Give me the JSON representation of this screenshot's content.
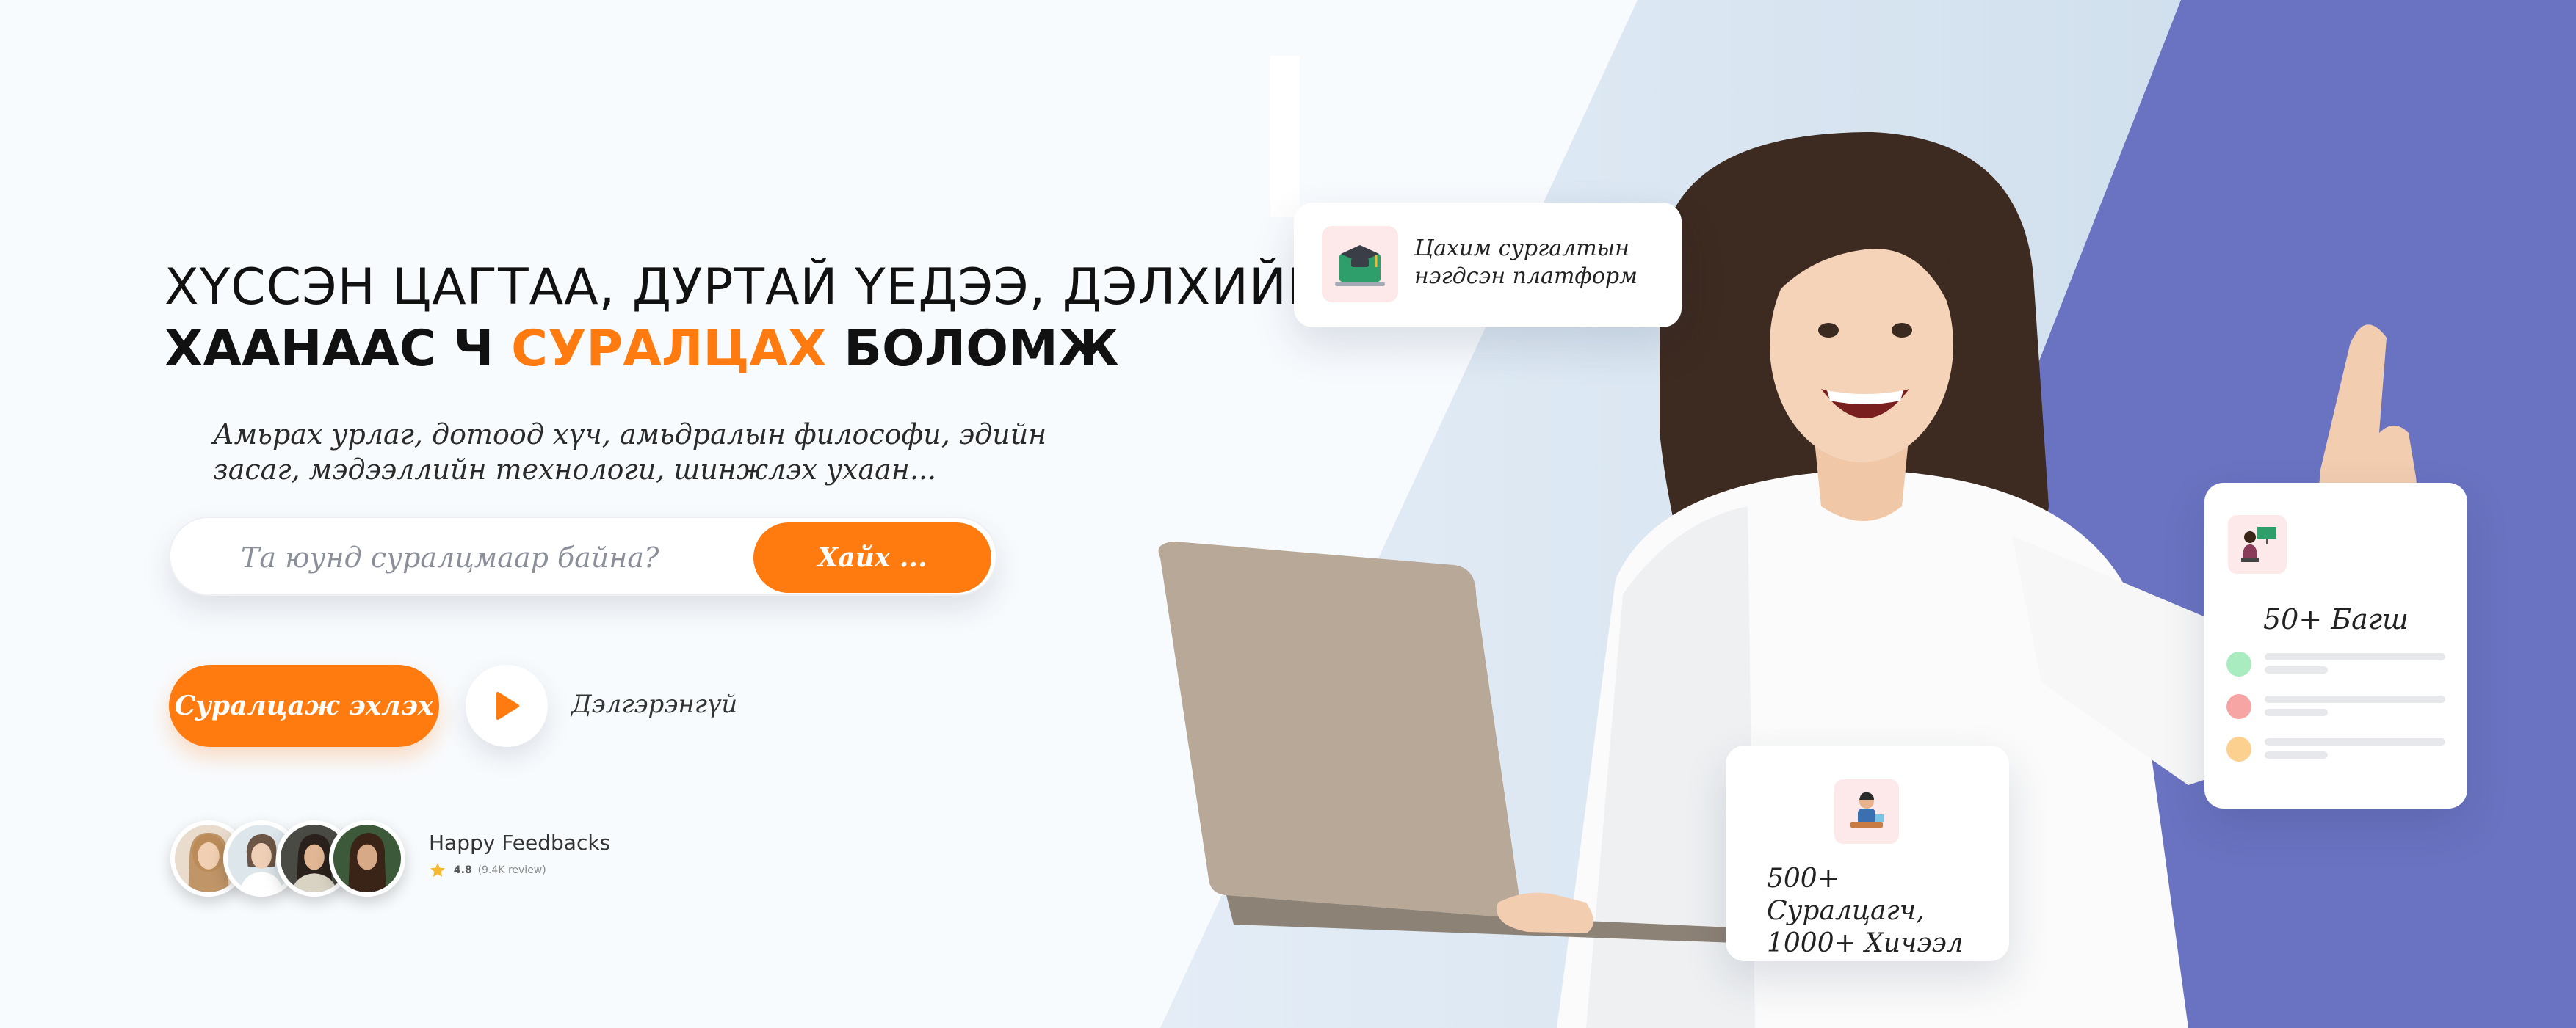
{
  "colors": {
    "accent": "#ff7a0f",
    "background": "#f8fbfe",
    "panel_light": "#d3e2f0",
    "panel_purple": "#6a73c1"
  },
  "hero": {
    "headline_line1": "ХҮССЭН ЦАГТАА, ДУРТАЙ ҮЕДЭЭ, ДЭЛХИЙН",
    "headline_line2_pre": "ХААНААС Ч ",
    "headline_line2_accent": "СУРАЛЦАХ",
    "headline_line2_post": " БОЛОМЖ",
    "subtitle": "Амьрах урлаг, дотоод хүч, амьдралын философи, эдийн засаг, мэдээллийн технологи, шинжлэх ухаан..."
  },
  "search": {
    "placeholder": "Та юунд суралцмаар байна?",
    "button_label": "Хайх ..."
  },
  "cta": {
    "start_label": "Суралцаж эхлэх",
    "play_icon": "play-icon",
    "more_label": "Дэлгэрэнгүй"
  },
  "feedback": {
    "title": "Happy Feedbacks",
    "rating": "4.8",
    "reviews": "(9.4K review)",
    "avatars": [
      "avatar-1",
      "avatar-2",
      "avatar-3",
      "avatar-4"
    ]
  },
  "cards": {
    "platform": {
      "icon": "graduation-laptop-icon",
      "text": "Цахим сургалтын нэгдсэн платформ"
    },
    "students": {
      "icon": "student-icon",
      "line1": "500+ Суралцагч,",
      "line2": "1000+ Хичээл"
    },
    "teachers": {
      "icon": "teacher-icon",
      "title": "50+ Багш",
      "row_colors": [
        "#a8ecc0",
        "#f6a4a4",
        "#fcd08f"
      ]
    }
  }
}
